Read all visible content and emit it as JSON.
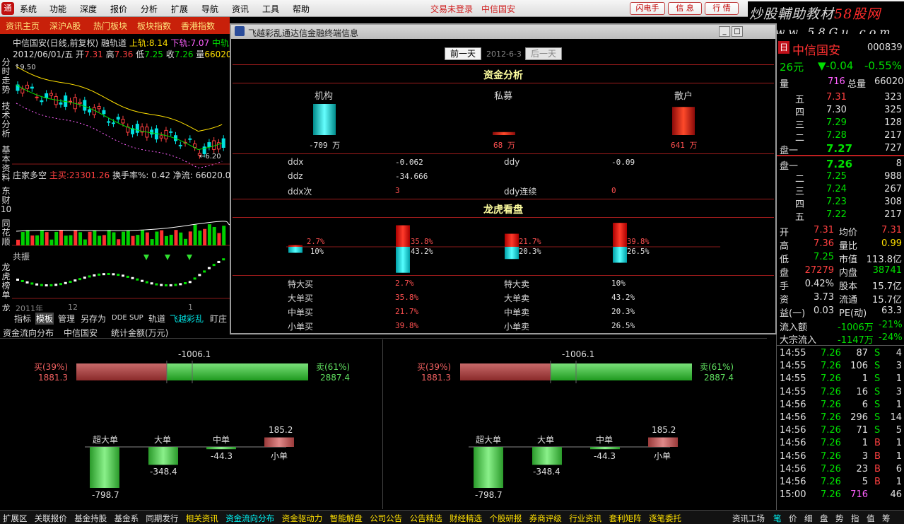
{
  "menubar": {
    "items": [
      "系统",
      "功能",
      "深度",
      "报价",
      "分析",
      "扩展",
      "导航",
      "资讯",
      "工具",
      "帮助"
    ],
    "login_status": "交易未登录",
    "stock_title": "中信国安",
    "quick_buttons": [
      "闪电手",
      "信 息",
      "行 情"
    ]
  },
  "brand": {
    "text_a": "炒股輔助教材",
    "text_b": "58股网",
    "url": "www.58Gu.com"
  },
  "tabbar": {
    "items": [
      "资讯主页",
      "深沪A股",
      "热门板块",
      "板块指数",
      "香港指数"
    ]
  },
  "kline": {
    "header1": "中信国安(日线,前复权) 融轨道",
    "upper_label": "上轨:",
    "upper_value": "8.14",
    "lower_label": "下轨:",
    "lower_value": "7.07",
    "mid_label": "中轨",
    "header2_date": "2012/06/01/五",
    "open_label": "开",
    "open_value": "7.31",
    "high_label": "高",
    "high_value": "7.36",
    "low_label": "低",
    "low_value": "7.25",
    "close_label": "收",
    "close_value": "7.26",
    "vol_label": "量",
    "vol_value": "66020.0",
    "price_high_mark": "9.50",
    "price_low_mark": "6.20",
    "vol_header_name": "庄家多空",
    "vol_header_buy_label": "主买:",
    "vol_header_buy_value": "23301.26",
    "vol_header_turn": "换手率%: 0.42",
    "vol_header_net": "净流: 66020.00",
    "osc_label": "共振",
    "date_2011": "2011年",
    "date_12": "12",
    "date_1": "1",
    "left_nav": [
      "分时走势",
      "技术分析",
      "基本资料",
      "东财10",
      "同花顺",
      "龙虎榜单",
      "龙虎"
    ],
    "indicator_tabs": [
      "指标",
      "模板",
      "管理",
      "另存为",
      "DDE",
      "SUP",
      "轨道",
      "飞越彩乱",
      "盯庄"
    ]
  },
  "dialog": {
    "title": "飞越彩乱通达信金融终端信息",
    "prev_btn": "前一天",
    "date": "2012-6-3",
    "next_btn": "后一天",
    "sec1_title": "资金分析",
    "inst_label": "机构",
    "inst_value": "-709 万",
    "private_label": "私募",
    "private_value": "68 万",
    "retail_label": "散户",
    "retail_value": "641 万",
    "ddx_label": "ddx",
    "ddx_value": "-0.062",
    "ddy_label": "ddy",
    "ddy_value": "-0.09",
    "ddz_label": "ddz",
    "ddz_value": "-34.666",
    "ddxn_label": "ddx次",
    "ddxn_value": "3",
    "ddyl_label": "ddy连续",
    "ddyl_value": "0",
    "sec2_title": "龙虎看盘",
    "lh_bars": [
      {
        "buy": "2.7%",
        "sell": "10%",
        "buy_v": 2.7,
        "sell_v": 10
      },
      {
        "buy": "35.8%",
        "sell": "43.2%",
        "buy_v": 35.8,
        "sell_v": 43.2
      },
      {
        "buy": "21.7%",
        "sell": "20.3%",
        "buy_v": 21.7,
        "sell_v": 20.3
      },
      {
        "buy": "39.8%",
        "sell": "26.5%",
        "buy_v": 39.8,
        "sell_v": 26.5
      }
    ],
    "rows": [
      {
        "a": "特大买",
        "av": "2.7%",
        "b": "特大卖",
        "bv": "10%"
      },
      {
        "a": "大单买",
        "av": "35.8%",
        "b": "大单卖",
        "bv": "43.2%"
      },
      {
        "a": "中单买",
        "av": "21.7%",
        "b": "中单卖",
        "bv": "20.3%"
      },
      {
        "a": "小单买",
        "av": "39.8%",
        "b": "小单卖",
        "bv": "26.5%"
      }
    ]
  },
  "fund": {
    "header_title": "资金流向分布",
    "header_stock": "中信国安",
    "header_unit": "统计金额(万元)",
    "net_value": "-1006.1",
    "buy_label": "买(39%)",
    "buy_value": "1881.3",
    "sell_label": "卖(61%)",
    "sell_value": "2887.4",
    "buy_ratio": 0.39,
    "cats": [
      {
        "label": "超大单",
        "value": "-798.7",
        "v": -798.7
      },
      {
        "label": "大单",
        "value": "-348.4",
        "v": -348.4
      },
      {
        "label": "中单",
        "value": "-44.3",
        "v": -44.3
      },
      {
        "label": "小单",
        "value": "185.2",
        "v": 185.2
      }
    ]
  },
  "quote": {
    "name": "中信国安",
    "code": "000839",
    "price_frag": "26元",
    "change": "▼-0.04",
    "change_pct": "-0.55%",
    "vol_label": "量",
    "vol_val": "716",
    "total_label": "总量",
    "total_val": "66020",
    "asks": [
      {
        "l": "五",
        "p": "7.31",
        "v": "323",
        "c": "up"
      },
      {
        "l": "四",
        "p": "7.30",
        "v": "325",
        "c": "wh"
      },
      {
        "l": "三",
        "p": "7.29",
        "v": "128",
        "c": "dn"
      },
      {
        "l": "二",
        "p": "7.28",
        "v": "217",
        "c": "dn"
      },
      {
        "l": "盘一",
        "p": "7.27",
        "v": "727",
        "c": "dn"
      }
    ],
    "bids": [
      {
        "l": "盘一",
        "p": "7.26",
        "v": "8",
        "c": "dn"
      },
      {
        "l": "二",
        "p": "7.25",
        "v": "988",
        "c": "dn"
      },
      {
        "l": "三",
        "p": "7.24",
        "v": "267",
        "c": "dn"
      },
      {
        "l": "四",
        "p": "7.23",
        "v": "308",
        "c": "dn"
      },
      {
        "l": "五",
        "p": "7.22",
        "v": "217",
        "c": "dn"
      }
    ],
    "stats": [
      {
        "l1": "开",
        "v1": "7.31",
        "c1": "up",
        "l2": "均价",
        "v2": "7.31",
        "c2": "up"
      },
      {
        "l1": "高",
        "v1": "7.36",
        "c1": "up",
        "l2": "量比",
        "v2": "0.99",
        "c2": "yl"
      },
      {
        "l1": "低",
        "v1": "7.25",
        "c1": "dn",
        "l2": "市值",
        "v2": "113.8亿",
        "c2": "wh"
      },
      {
        "l1": "盘",
        "v1": "27279",
        "c1": "up",
        "l2": "内盘",
        "v2": "38741",
        "c2": "dn"
      },
      {
        "l1": "手",
        "v1": "0.42%",
        "c1": "wh",
        "l2": "股本",
        "v2": "15.7亿",
        "c2": "wh"
      },
      {
        "l1": "资",
        "v1": "3.73",
        "c1": "wh",
        "l2": "流通",
        "v2": "15.7亿",
        "c2": "wh"
      },
      {
        "l1": "益(一)",
        "v1": "0.03",
        "c1": "wh",
        "l2": "PE(动)",
        "v2": "63.3",
        "c2": "wh"
      }
    ],
    "inflow_label": "流入额",
    "inflow_val": "-1006万",
    "inflow_pct": "-21%",
    "big_label": "大宗流入",
    "big_val": "-1147万",
    "big_pct": "-24%",
    "ticks": [
      {
        "t": "14:55",
        "p": "7.26",
        "v": "87",
        "bs": "S",
        "n": "4"
      },
      {
        "t": "14:55",
        "p": "7.26",
        "v": "106",
        "bs": "S",
        "n": "3"
      },
      {
        "t": "14:55",
        "p": "7.26",
        "v": "1",
        "bs": "S",
        "n": "1"
      },
      {
        "t": "14:55",
        "p": "7.26",
        "v": "16",
        "bs": "S",
        "n": "3"
      },
      {
        "t": "14:56",
        "p": "7.26",
        "v": "6",
        "bs": "S",
        "n": "1"
      },
      {
        "t": "14:56",
        "p": "7.26",
        "v": "296",
        "bs": "S",
        "n": "14"
      },
      {
        "t": "14:56",
        "p": "7.26",
        "v": "71",
        "bs": "S",
        "n": "5"
      },
      {
        "t": "14:56",
        "p": "7.26",
        "v": "1",
        "bs": "B",
        "n": "1"
      },
      {
        "t": "14:56",
        "p": "7.26",
        "v": "3",
        "bs": "B",
        "n": "1"
      },
      {
        "t": "14:56",
        "p": "7.26",
        "v": "23",
        "bs": "B",
        "n": "6"
      },
      {
        "t": "14:56",
        "p": "7.26",
        "v": "5",
        "bs": "B",
        "n": "1"
      },
      {
        "t": "15:00",
        "p": "7.26",
        "v": "716",
        "bs": "",
        "n": "46"
      }
    ]
  },
  "statusbar": {
    "items": [
      "扩展区",
      "关联报价",
      "基金持股",
      "基金系",
      "同期发行",
      "相关资讯",
      "资金流向分布",
      "资金驱动力",
      "智能解盘",
      "公司公告",
      "公告精选",
      "财经精选",
      "个股研报",
      "券商评级",
      "行业资讯",
      "套利矩阵",
      "逐笔委托"
    ],
    "right_items": [
      "资讯工场",
      "笔",
      "价",
      "细",
      "盘",
      "势",
      "指",
      "值",
      "筹"
    ]
  },
  "colors": {
    "up": "#ff4040",
    "down": "#00e000",
    "cyan": "#00e0e0",
    "accent": "#c8200a"
  }
}
